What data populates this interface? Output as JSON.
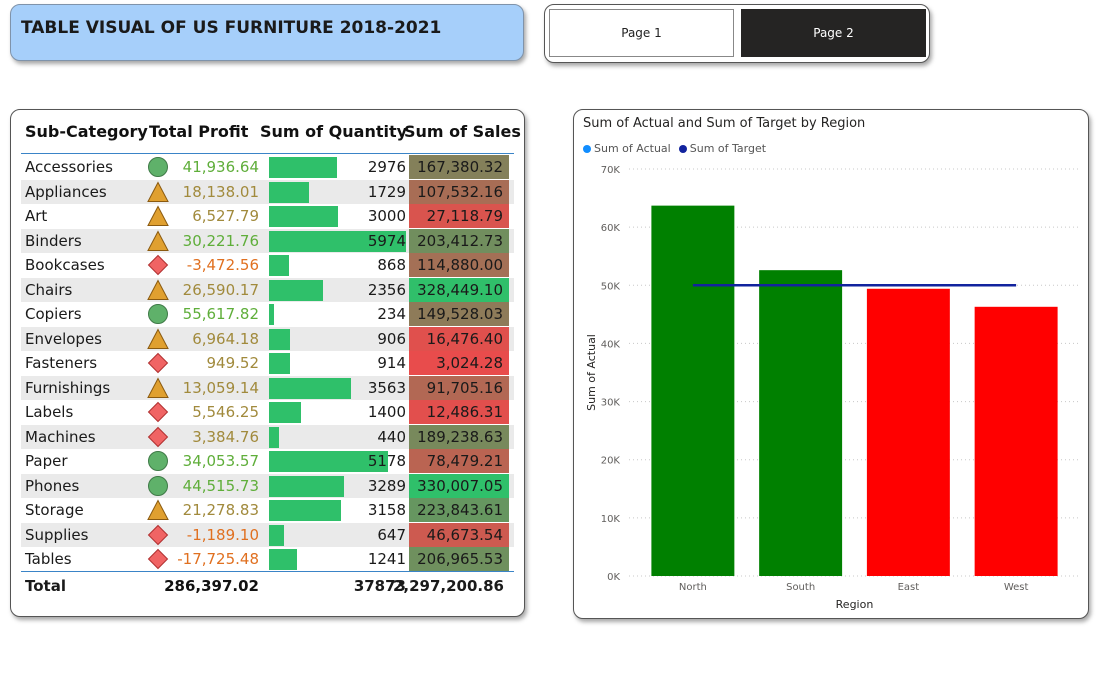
{
  "header": {
    "title": "TABLE VISUAL OF US FURNITURE  2018-2021"
  },
  "nav": {
    "page1": "Page 1",
    "page2": "Page 2"
  },
  "table": {
    "columns": [
      "Sub-Category",
      "Total Profit",
      "Sum of Quantity",
      "Sum of Sales"
    ],
    "rows": [
      {
        "name": "Accessories",
        "icon": "circle",
        "profit": "41,936.64",
        "qty": "2976",
        "sales": "167,380.32"
      },
      {
        "name": "Appliances",
        "icon": "triangle",
        "profit": "18,138.01",
        "qty": "1729",
        "sales": "107,532.16"
      },
      {
        "name": "Art",
        "icon": "triangle",
        "profit": "6,527.79",
        "qty": "3000",
        "sales": "27,118.79"
      },
      {
        "name": "Binders",
        "icon": "triangle",
        "profit": "30,221.76",
        "qty": "5974",
        "sales": "203,412.73"
      },
      {
        "name": "Bookcases",
        "icon": "diamond",
        "profit": "-3,472.56",
        "qty": "868",
        "sales": "114,880.00"
      },
      {
        "name": "Chairs",
        "icon": "triangle",
        "profit": "26,590.17",
        "qty": "2356",
        "sales": "328,449.10"
      },
      {
        "name": "Copiers",
        "icon": "circle",
        "profit": "55,617.82",
        "qty": "234",
        "sales": "149,528.03"
      },
      {
        "name": "Envelopes",
        "icon": "triangle",
        "profit": "6,964.18",
        "qty": "906",
        "sales": "16,476.40"
      },
      {
        "name": "Fasteners",
        "icon": "diamond",
        "profit": "949.52",
        "qty": "914",
        "sales": "3,024.28"
      },
      {
        "name": "Furnishings",
        "icon": "triangle",
        "profit": "13,059.14",
        "qty": "3563",
        "sales": "91,705.16"
      },
      {
        "name": "Labels",
        "icon": "diamond",
        "profit": "5,546.25",
        "qty": "1400",
        "sales": "12,486.31"
      },
      {
        "name": "Machines",
        "icon": "diamond",
        "profit": "3,384.76",
        "qty": "440",
        "sales": "189,238.63"
      },
      {
        "name": "Paper",
        "icon": "circle",
        "profit": "34,053.57",
        "qty": "5178",
        "sales": "78,479.21"
      },
      {
        "name": "Phones",
        "icon": "circle",
        "profit": "44,515.73",
        "qty": "3289",
        "sales": "330,007.05"
      },
      {
        "name": "Storage",
        "icon": "triangle",
        "profit": "21,278.83",
        "qty": "3158",
        "sales": "223,843.61"
      },
      {
        "name": "Supplies",
        "icon": "diamond",
        "profit": "-1,189.10",
        "qty": "647",
        "sales": "46,673.54"
      },
      {
        "name": "Tables",
        "icon": "diamond",
        "profit": "-17,725.48",
        "qty": "1241",
        "sales": "206,965.53"
      }
    ],
    "total": {
      "label": "Total",
      "profit": "286,397.02",
      "qty": "37873",
      "sales": "2,297,200.86"
    },
    "colors": {
      "qty_bar": "#2fc06a",
      "sales_low": "#e84c4c",
      "sales_mid": "#84805a",
      "sales_high": "#2fc06a",
      "icon_circle": "#5fb16a",
      "icon_triangle": "#e0a030",
      "icon_diamond": "#f06464",
      "profit_high": "#5fae3a",
      "profit_mid": "#a18a3c",
      "profit_low": "#e07020"
    }
  },
  "chart_data": {
    "type": "bar",
    "title": "Sum of Actual and Sum of Target by Region",
    "xlabel": "Region",
    "ylabel": "Sum of Actual",
    "categories": [
      "North",
      "South",
      "East",
      "West"
    ],
    "series": [
      {
        "name": "Sum of Actual",
        "type": "bar",
        "values": [
          63700,
          52600,
          49400,
          46300
        ],
        "bar_colors": [
          "#008000",
          "#008000",
          "#ff0000",
          "#ff0000"
        ]
      },
      {
        "name": "Sum of Target",
        "type": "line",
        "values": [
          50000,
          50000,
          50000,
          50000
        ]
      }
    ],
    "ylim": [
      0,
      70000
    ],
    "yticks": [
      0,
      10000,
      20000,
      30000,
      40000,
      50000,
      60000,
      70000
    ],
    "ytick_labels": [
      "0K",
      "10K",
      "20K",
      "30K",
      "40K",
      "50K",
      "60K",
      "70K"
    ],
    "grid": true,
    "legend_position": "top-left",
    "legend_colors": [
      "#118dff",
      "#12239e"
    ]
  }
}
